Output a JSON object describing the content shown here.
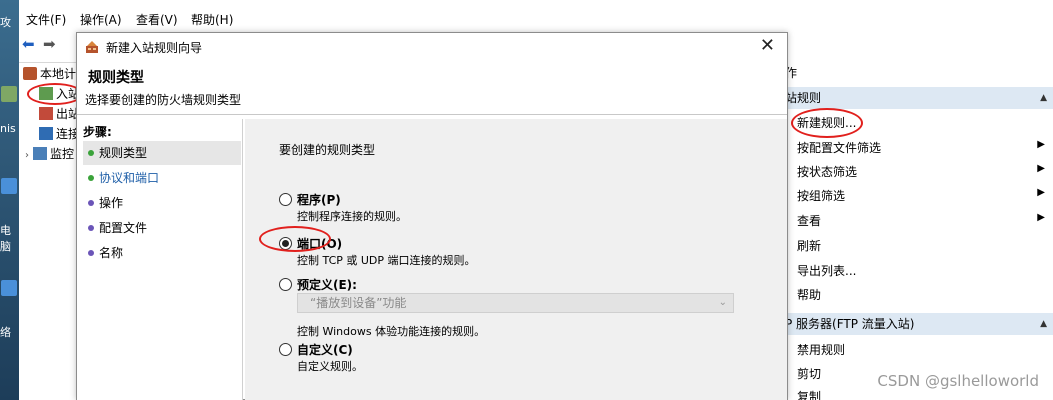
{
  "menubar": {
    "items": [
      "文件(F)",
      "操作(A)",
      "查看(V)",
      "帮助(H)"
    ]
  },
  "desktop": {
    "labels": [
      "攻",
      "nis",
      "电脑",
      "络"
    ]
  },
  "tree": {
    "items": [
      {
        "label": "本地计",
        "icon": "firewall-icon"
      },
      {
        "label": "入站",
        "icon": "inbound-rules-icon"
      },
      {
        "label": "出站",
        "icon": "outbound-rules-icon"
      },
      {
        "label": "连接",
        "icon": "connection-security-icon"
      },
      {
        "label": "监控",
        "icon": "monitor-icon"
      }
    ]
  },
  "dialog": {
    "title": "新建入站规则向导",
    "close_label": "✕",
    "heading": "规则类型",
    "subheading": "选择要创建的防火墙规则类型",
    "steps_header": "步骤:",
    "steps": [
      {
        "label": "规则类型",
        "active": true
      },
      {
        "label": "协议和端口",
        "active": false
      },
      {
        "label": "操作",
        "active": false
      },
      {
        "label": "配置文件",
        "active": false
      },
      {
        "label": "名称",
        "active": false
      }
    ],
    "question": "要创建的规则类型",
    "options": [
      {
        "label": "程序(P)",
        "desc": "控制程序连接的规则。",
        "checked": false
      },
      {
        "label": "端口(O)",
        "desc": "控制 TCP 或 UDP 端口连接的规则。",
        "checked": true
      },
      {
        "label": "预定义(E):",
        "desc": "控制 Windows 体验功能连接的规则。",
        "checked": false
      },
      {
        "label": "自定义(C)",
        "desc": "自定义规则。",
        "checked": false
      }
    ],
    "predefined_combo": "“播放到设备”功能"
  },
  "actions": {
    "header_top": "作",
    "section1_title": "站规则",
    "items1": [
      {
        "label": "新建规则...",
        "arrow": false
      },
      {
        "label": "按配置文件筛选",
        "arrow": true
      },
      {
        "label": "按状态筛选",
        "arrow": true
      },
      {
        "label": "按组筛选",
        "arrow": true
      },
      {
        "label": "查看",
        "arrow": true
      },
      {
        "label": "刷新",
        "arrow": false
      },
      {
        "label": "导出列表...",
        "arrow": false
      },
      {
        "label": "帮助",
        "arrow": false
      }
    ],
    "section2_title": "P 服务器(FTP 流量入站)",
    "items2": [
      {
        "label": "禁用规则"
      },
      {
        "label": "剪切"
      },
      {
        "label": "复制"
      }
    ]
  },
  "watermark": "CSDN @gslhelloworld",
  "colors": {
    "accent_red": "#e1201d",
    "header_blue": "#dde8f3",
    "step_dot_active": "#3aa33a",
    "step_dot_inactive": "#6b55b8"
  }
}
